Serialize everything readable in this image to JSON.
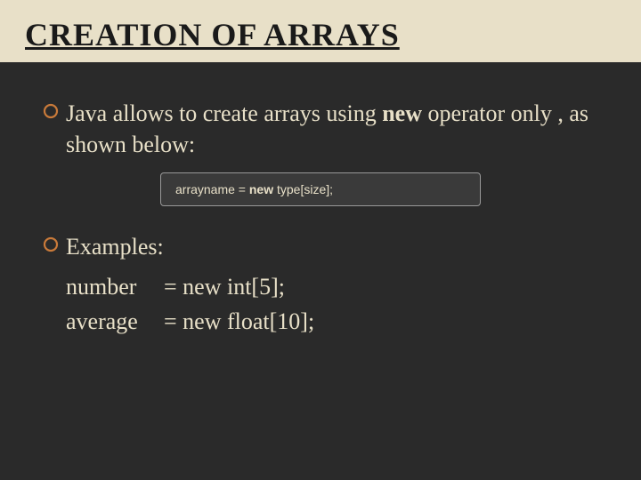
{
  "title": "CREATION OF ARRAYS",
  "bullet1": {
    "prefix": "Java allows to create arrays using ",
    "bold": "new",
    "suffix": " operator only , as shown below:"
  },
  "codebox": {
    "lhs": "arrayname = ",
    "kw": "new",
    "rhs": "  type[size];"
  },
  "examples": {
    "label": "Examples:",
    "rows": [
      {
        "name": "number",
        "expr": "= new int[5];"
      },
      {
        "name": "average",
        "expr": "= new float[10];"
      }
    ]
  }
}
